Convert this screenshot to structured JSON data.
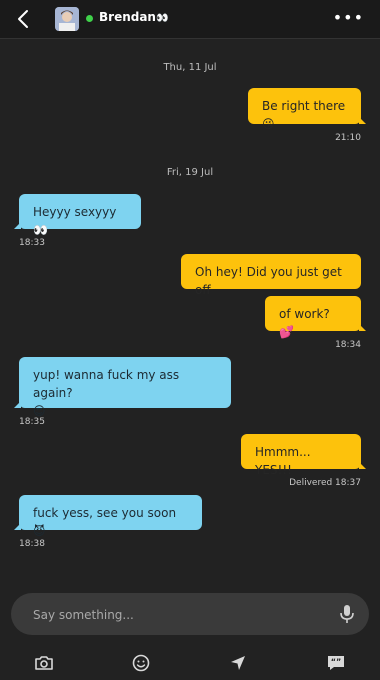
{
  "header": {
    "contact_name": "Brendan",
    "status": "online",
    "name_emoji": "👀",
    "icons": {
      "back": "chevron-left-icon",
      "more": "more-dots-icon"
    }
  },
  "messages": [
    {
      "type": "date",
      "text": "Thu, 11 Jul"
    },
    {
      "type": "out",
      "text": "Be right there",
      "emoji": "😘",
      "time": "21:10"
    },
    {
      "type": "date",
      "text": "Fri, 19 Jul"
    },
    {
      "type": "in",
      "text": "Heyyy sexyyy",
      "emoji": "👀",
      "time": "18:33"
    },
    {
      "type": "out",
      "text": "Oh hey! Did you just get off"
    },
    {
      "type": "out",
      "text": "of work?",
      "emoji": "💕",
      "time": "18:34"
    },
    {
      "type": "in",
      "text": "yup! wanna fuck my ass again?",
      "emoji": "😍",
      "time": "18:35"
    },
    {
      "type": "out",
      "text": "Hmmm... YES!!!",
      "time": "Delivered 18:37"
    },
    {
      "type": "in",
      "text": "fuck yess, see you soon",
      "emoji": "😈",
      "time": "18:38"
    }
  ],
  "composer": {
    "placeholder": "Say something...",
    "icon": "microphone-icon"
  },
  "tabbar": {
    "icons": [
      "camera-icon",
      "emoji-icon",
      "location-arrow-icon",
      "quick-phrases-icon"
    ]
  },
  "colors": {
    "background": "#222222",
    "outgoing": "#fdc20c",
    "incoming": "#7ed3f0",
    "online": "#3fd14a"
  }
}
